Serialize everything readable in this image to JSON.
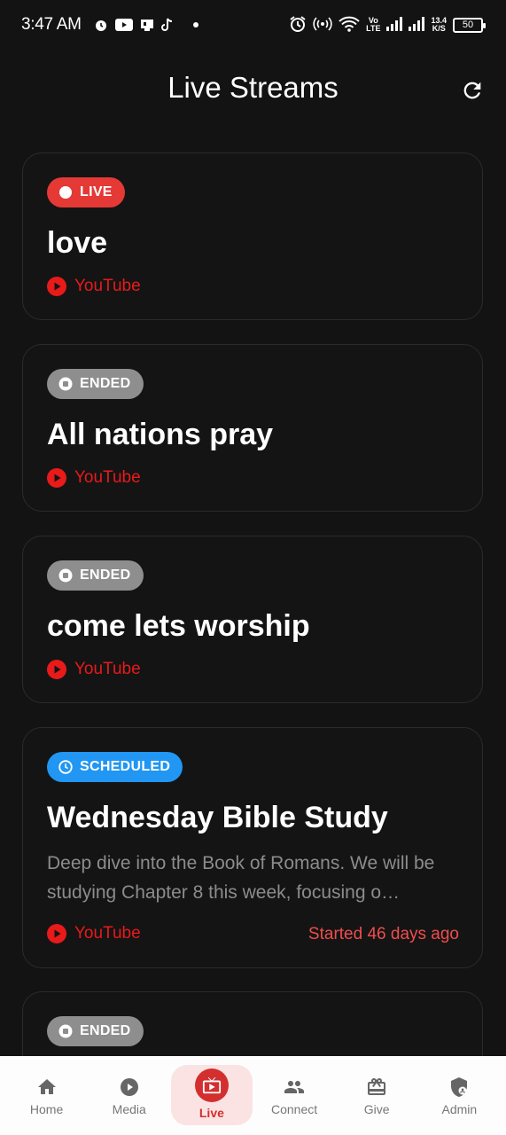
{
  "status_bar": {
    "time": "3:47 AM",
    "network_top": "Vo",
    "network_bottom": "LTE",
    "speed_value": "13.4",
    "speed_unit": "K/S",
    "battery": "50"
  },
  "header": {
    "title": "Live Streams"
  },
  "streams": [
    {
      "status": "LIVE",
      "title": "love",
      "platform": "YouTube"
    },
    {
      "status": "ENDED",
      "title": "All nations pray",
      "platform": "YouTube"
    },
    {
      "status": "ENDED",
      "title": "come lets worship",
      "platform": "YouTube"
    },
    {
      "status": "SCHEDULED",
      "title": "Wednesday Bible Study",
      "description": "Deep dive into the Book of Romans. We will be studying Chapter 8 this week, focusing o…",
      "platform": "YouTube",
      "started": "Started 46 days ago"
    },
    {
      "status": "ENDED"
    }
  ],
  "nav": [
    {
      "label": "Home",
      "icon": "home-icon"
    },
    {
      "label": "Media",
      "icon": "play-circle-icon"
    },
    {
      "label": "Live",
      "icon": "live-tv-icon",
      "active": true
    },
    {
      "label": "Connect",
      "icon": "people-icon"
    },
    {
      "label": "Give",
      "icon": "gift-icon"
    },
    {
      "label": "Admin",
      "icon": "admin-shield-icon"
    }
  ],
  "colors": {
    "background": "#131313",
    "live": "#e53935",
    "ended": "#8e8e8e",
    "scheduled": "#2196f3",
    "youtube": "#e81a1a",
    "nav_active": "#d32f2f"
  }
}
